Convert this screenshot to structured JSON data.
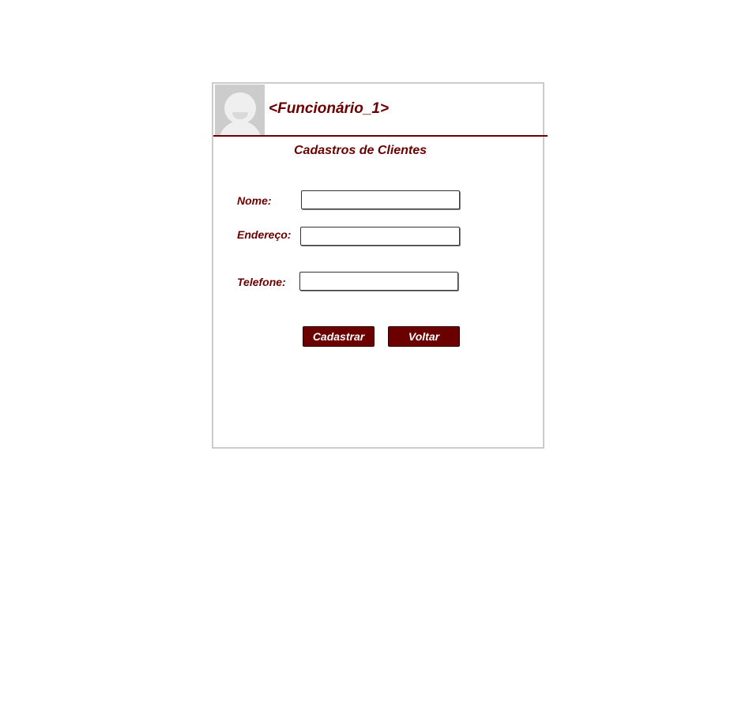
{
  "header": {
    "user_name": "<Funcionário_1>",
    "avatar_icon": "user-avatar-icon"
  },
  "page": {
    "title": "Cadastros de Clientes"
  },
  "form": {
    "nome_label": "Nome:",
    "nome_value": "",
    "endereco_label": "Endereço:",
    "endereco_value": "",
    "telefone_label": "Telefone:",
    "telefone_value": ""
  },
  "actions": {
    "cadastrar_label": "Cadastrar",
    "voltar_label": "Voltar"
  },
  "colors": {
    "accent": "#6b0000",
    "frame_border": "#cccccc",
    "avatar_bg": "#cccccc"
  }
}
